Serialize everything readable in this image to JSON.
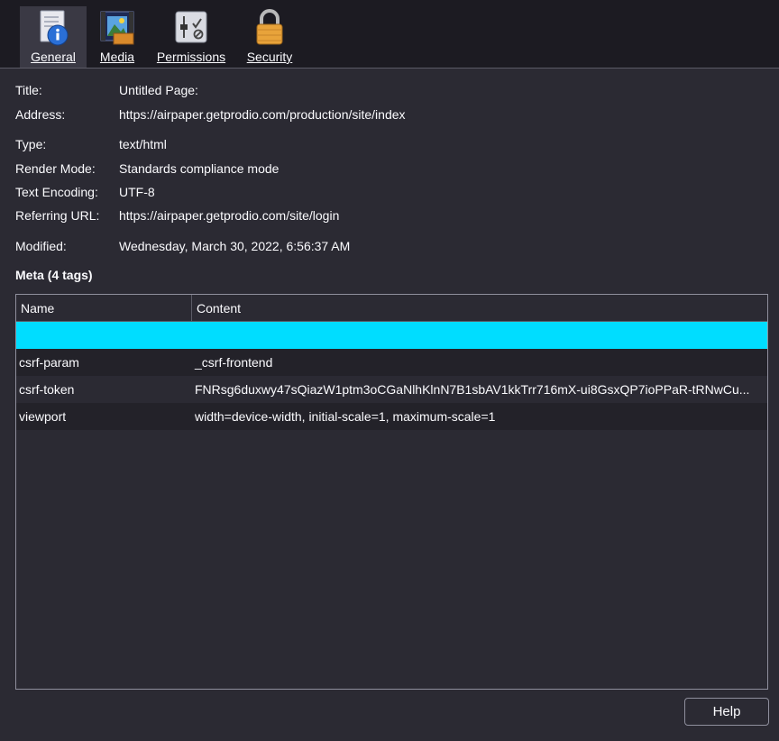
{
  "tabs": [
    {
      "label": "General",
      "icon": "info-icon",
      "selected": true
    },
    {
      "label": "Media",
      "icon": "media-icon",
      "selected": false
    },
    {
      "label": "Permissions",
      "icon": "permissions-icon",
      "selected": false
    },
    {
      "label": "Security",
      "icon": "lock-icon",
      "selected": false
    }
  ],
  "general": {
    "title_label": "Title:",
    "title_value": "Untitled Page:",
    "address_label": "Address:",
    "address_value": "https://airpaper.getprodio.com/production/site/index",
    "type_label": "Type:",
    "type_value": "text/html",
    "render_label": "Render Mode:",
    "render_value": "Standards compliance mode",
    "encoding_label": "Text Encoding:",
    "encoding_value": "UTF-8",
    "referring_label": "Referring URL:",
    "referring_value": "https://airpaper.getprodio.com/site/login",
    "modified_label": "Modified:",
    "modified_value": "Wednesday, March 30, 2022, 6:56:37 AM"
  },
  "meta": {
    "title": "Meta (4 tags)",
    "columns": {
      "name": "Name",
      "content": "Content"
    },
    "rows": [
      {
        "name": "",
        "content": ""
      },
      {
        "name": "csrf-param",
        "content": "_csrf-frontend"
      },
      {
        "name": "csrf-token",
        "content": "FNRsg6duxwy47sQiazW1ptm3oCGaNlhKlnN7B1sbAV1kkTrr716mX-ui8GsxQP7ioPPaR-tRNwCu..."
      },
      {
        "name": "viewport",
        "content": "width=device-width, initial-scale=1, maximum-scale=1"
      }
    ]
  },
  "footer": {
    "help_label": "Help"
  },
  "colors": {
    "selection": "#00ddff",
    "background": "#2b2a33",
    "toolbar": "#1c1b22"
  }
}
